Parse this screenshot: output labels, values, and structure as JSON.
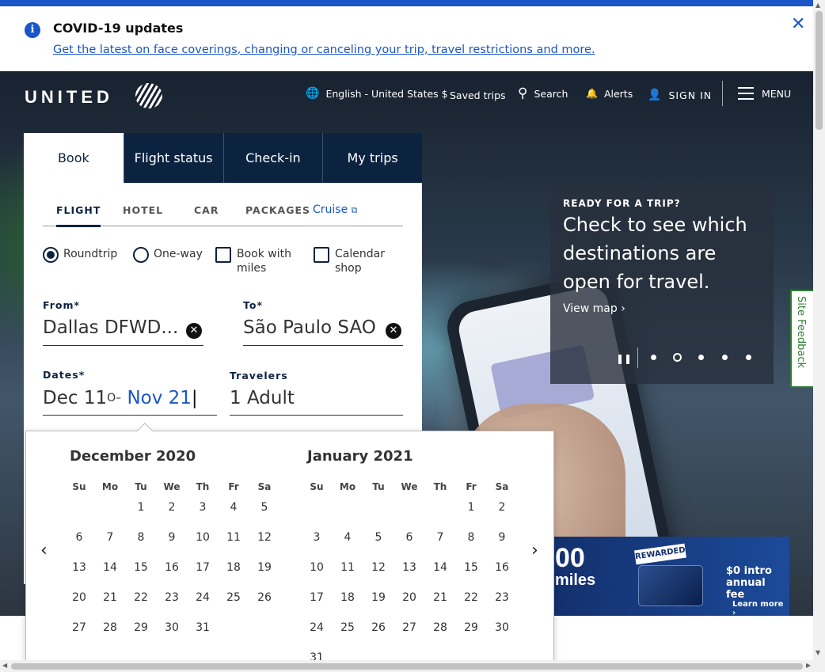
{
  "covid": {
    "title": "COVID-19 updates",
    "link": "Get the latest on face coverings, changing or canceling your trip, travel restrictions and more.",
    "close": "✕",
    "info": "i"
  },
  "header": {
    "logo_text": "UNITED",
    "nav": {
      "language": "English - United States $",
      "saved": "Saved trips",
      "search": "Search",
      "alerts": "Alerts",
      "signin": "SIGN IN",
      "menu": "MENU"
    }
  },
  "booking": {
    "tabs": [
      "Book",
      "Flight status",
      "Check-in",
      "My trips"
    ],
    "subtabs": [
      "FLIGHT",
      "HOTEL",
      "CAR",
      "PACKAGES",
      "Cruise"
    ],
    "options": {
      "roundtrip": "Roundtrip",
      "oneway": "One-way",
      "miles": "Book with miles",
      "calendar": "Calendar shop"
    },
    "from_label": "From*",
    "from_value": "Dallas DFWD...",
    "to_label": "To*",
    "to_value": "São Paulo SAO",
    "dates_label": "Dates*",
    "depart_value": "Dec 11",
    "return_value": "Nov 21",
    "travelers_label": "Travelers",
    "travelers_value": "1 Adult"
  },
  "calendar": {
    "dow": [
      "Su",
      "Mo",
      "Tu",
      "We",
      "Th",
      "Fr",
      "Sa"
    ],
    "months": [
      {
        "title": "December 2020",
        "weeks": [
          [
            "",
            "",
            "1",
            "2",
            "3",
            "4",
            "5"
          ],
          [
            "6",
            "7",
            "8",
            "9",
            "10",
            "11",
            "12"
          ],
          [
            "13",
            "14",
            "15",
            "16",
            "17",
            "18",
            "19"
          ],
          [
            "20",
            "21",
            "22",
            "23",
            "24",
            "25",
            "26"
          ],
          [
            "27",
            "28",
            "29",
            "30",
            "31",
            "",
            ""
          ]
        ]
      },
      {
        "title": "January 2021",
        "weeks": [
          [
            "",
            "",
            "",
            "",
            "",
            "1",
            "2"
          ],
          [
            "3",
            "4",
            "5",
            "6",
            "7",
            "8",
            "9"
          ],
          [
            "10",
            "11",
            "12",
            "13",
            "14",
            "15",
            "16"
          ],
          [
            "17",
            "18",
            "19",
            "20",
            "21",
            "22",
            "23"
          ],
          [
            "24",
            "25",
            "26",
            "27",
            "28",
            "29",
            "30"
          ],
          [
            "31",
            "",
            "",
            "",
            "",
            "",
            ""
          ]
        ]
      }
    ]
  },
  "promo": {
    "eyebrow": "READY FOR A TRIP?",
    "headline": "Check to see which destinations are open for travel.",
    "link": "View map ›",
    "slide_count": 5,
    "active_slide": 2
  },
  "ad": {
    "miles_number": "00",
    "miles_word": "miles",
    "badge": "REWARDED",
    "fee": "$0 intro annual fee",
    "more": "Learn more ›"
  },
  "feedback": "Site Feedback",
  "colors": {
    "brand_navy": "#0c2340",
    "link_blue": "#1a56c7",
    "feedback_green": "#2e7d32"
  }
}
